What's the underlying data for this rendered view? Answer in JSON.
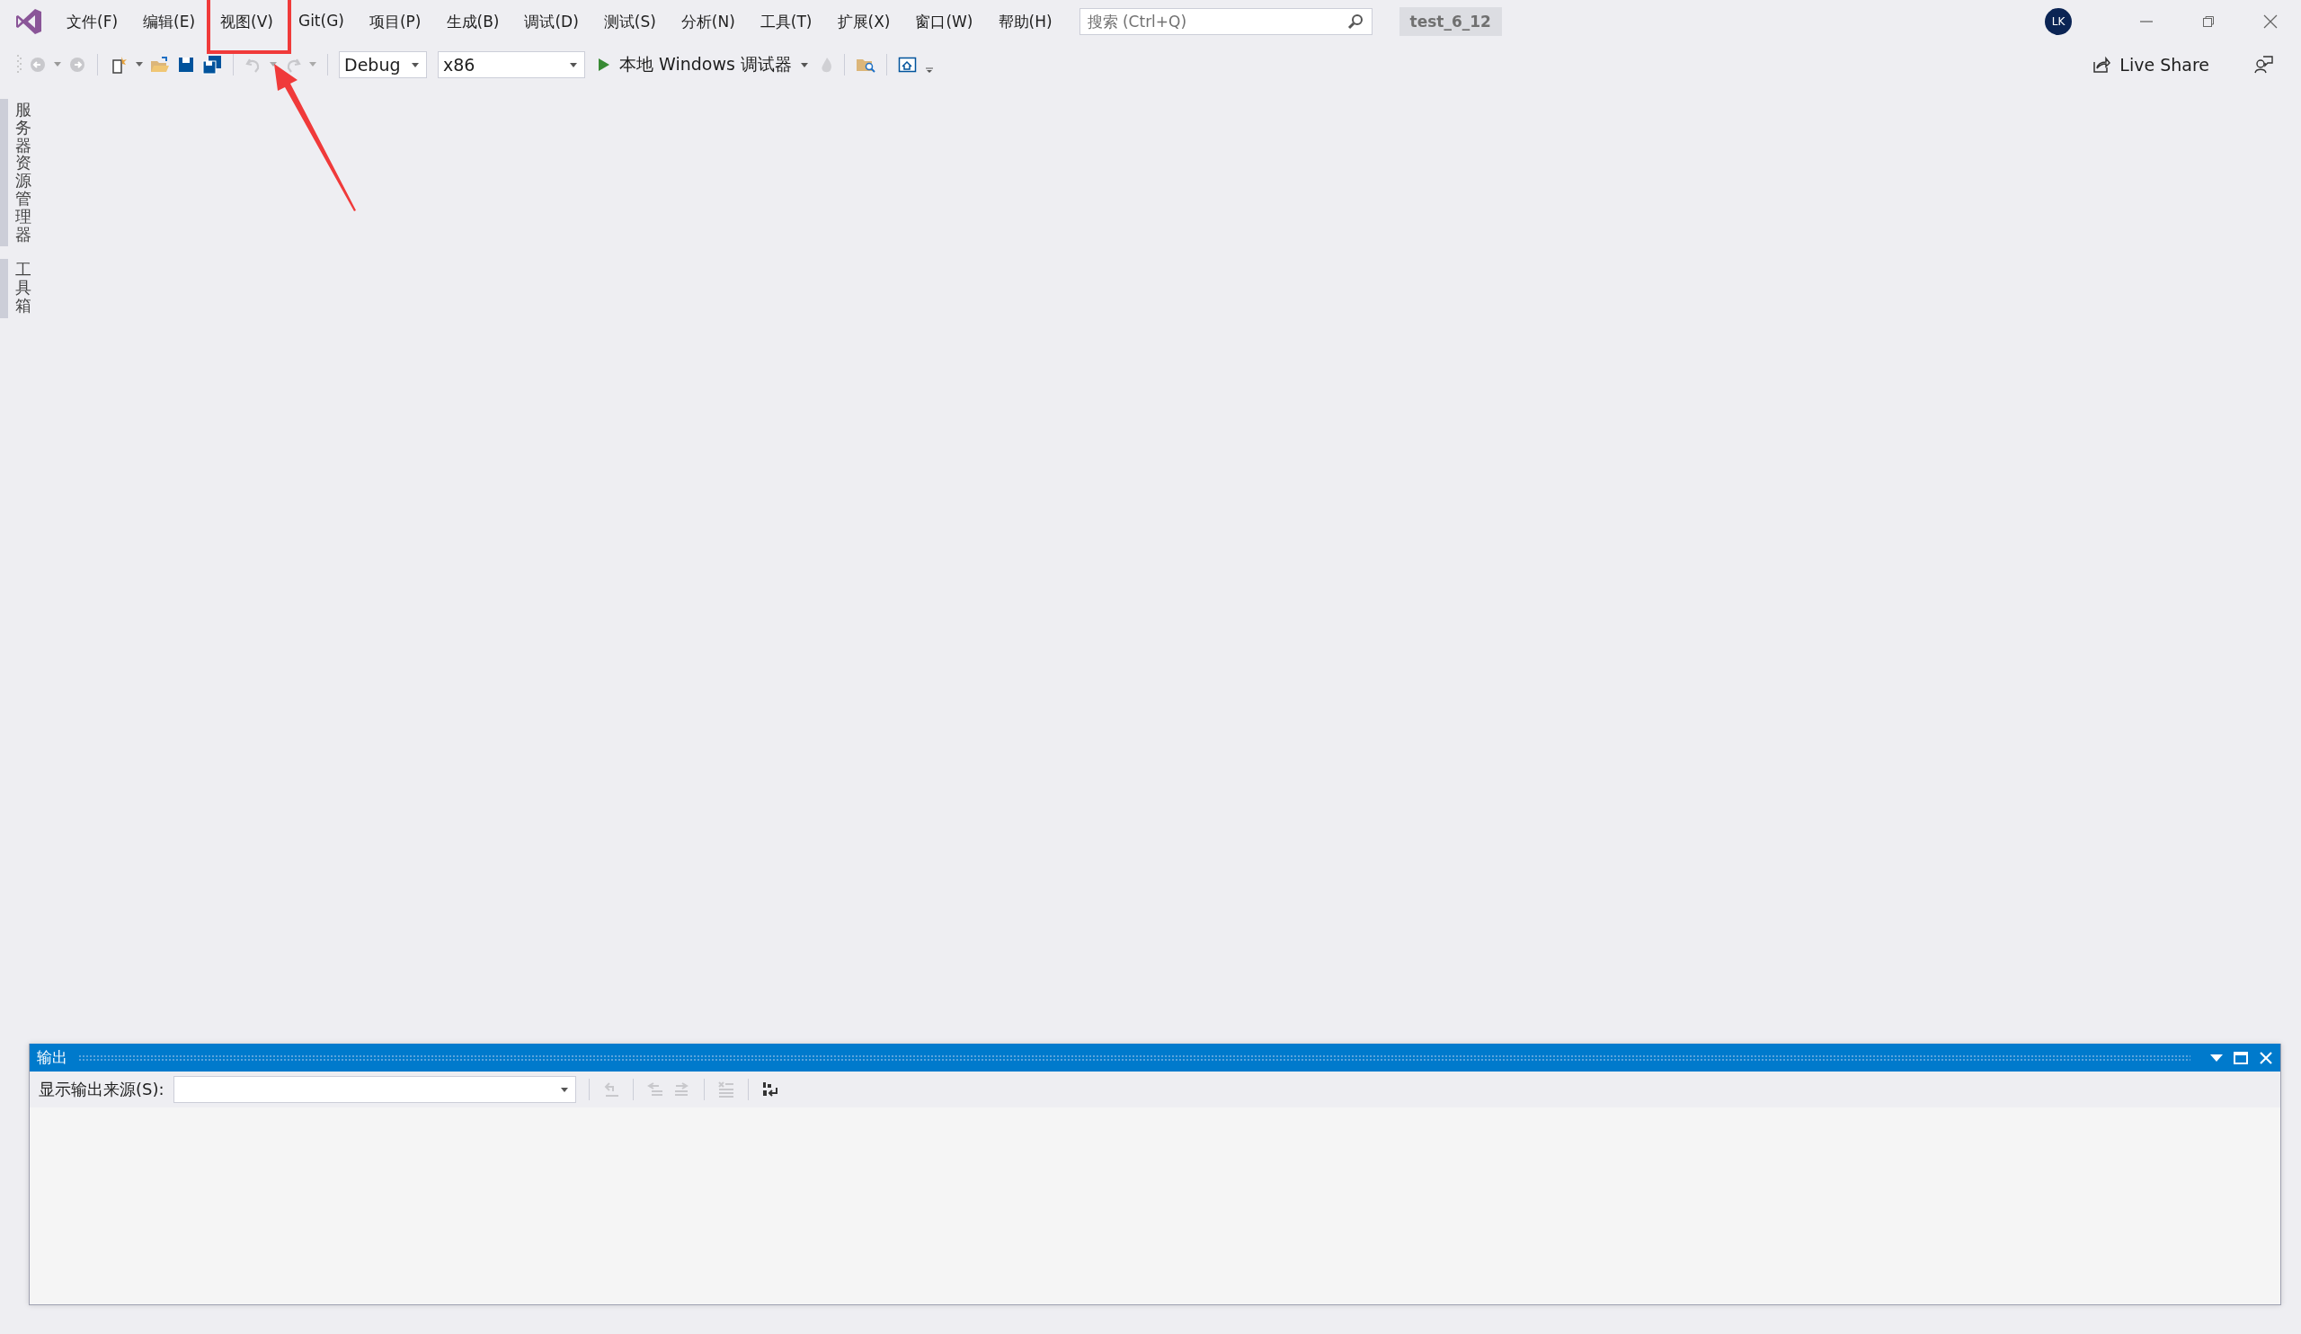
{
  "window": {
    "title_badge": "test_6_12",
    "user_initials": "LK"
  },
  "menu": [
    {
      "label": "文件(F)",
      "annotated": false
    },
    {
      "label": "编辑(E)",
      "annotated": false
    },
    {
      "label": "视图(V)",
      "annotated": true
    },
    {
      "label": "Git(G)",
      "annotated": false
    },
    {
      "label": "项目(P)",
      "annotated": false
    },
    {
      "label": "生成(B)",
      "annotated": false
    },
    {
      "label": "调试(D)",
      "annotated": false
    },
    {
      "label": "测试(S)",
      "annotated": false
    },
    {
      "label": "分析(N)",
      "annotated": false
    },
    {
      "label": "工具(T)",
      "annotated": false
    },
    {
      "label": "扩展(X)",
      "annotated": false
    },
    {
      "label": "窗口(W)",
      "annotated": false
    },
    {
      "label": "帮助(H)",
      "annotated": false
    }
  ],
  "search": {
    "placeholder": "搜索 (Ctrl+Q)"
  },
  "toolbar": {
    "configuration": "Debug",
    "platform": "x86",
    "run_target": "本地 Windows 调试器",
    "live_share": "Live Share"
  },
  "side_tabs": [
    {
      "label": "服务器资源管理器"
    },
    {
      "label": "工具箱"
    }
  ],
  "output_panel": {
    "title": "输出",
    "source_label": "显示输出来源(S):"
  }
}
